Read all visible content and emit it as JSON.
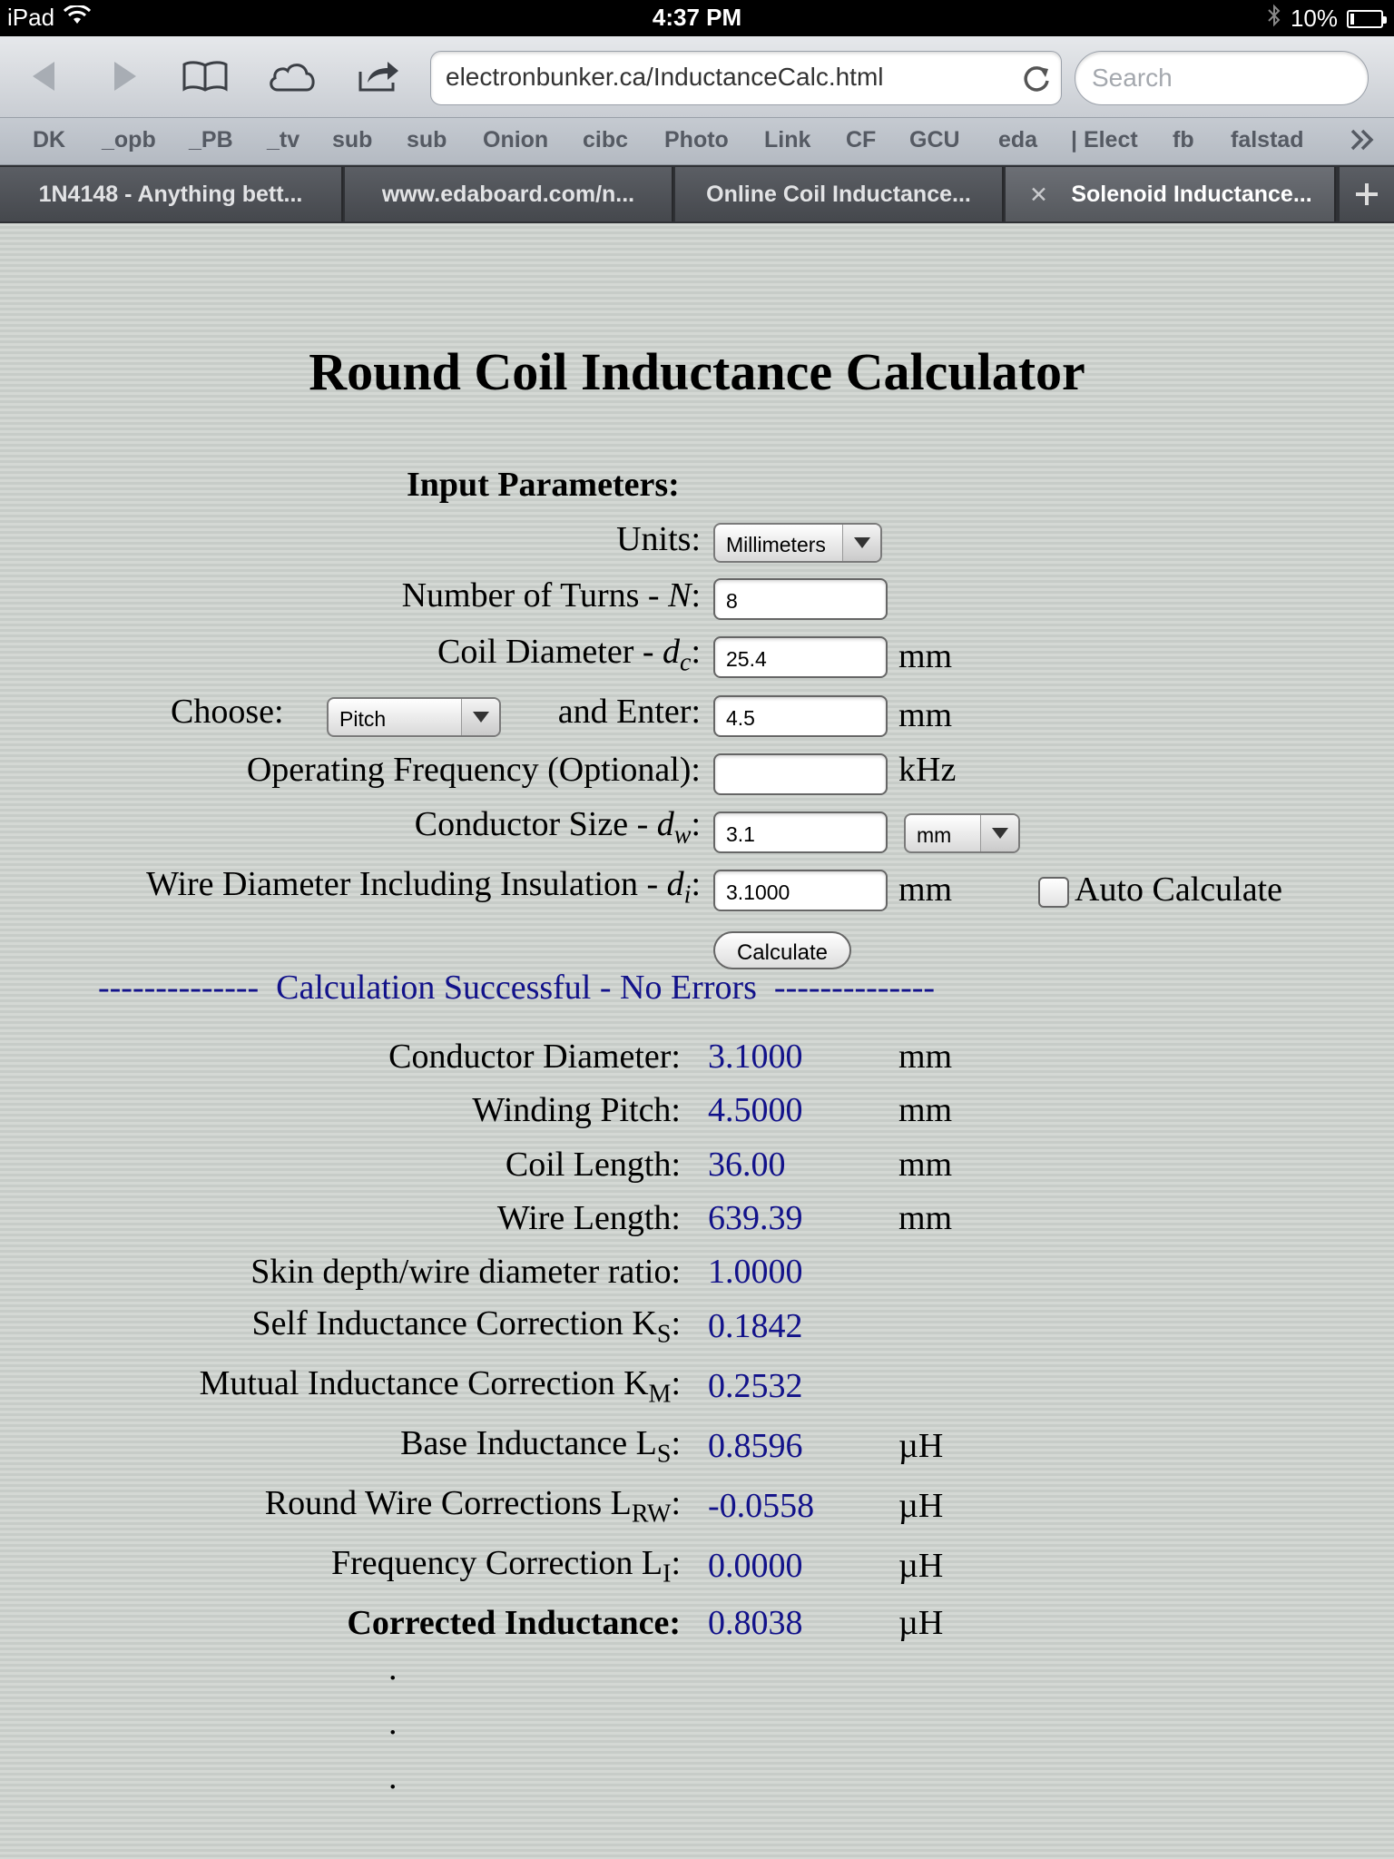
{
  "status_bar": {
    "device": "iPad",
    "time": "4:37 PM",
    "battery": "10%"
  },
  "toolbar": {
    "url": "electronbunker.ca/InductanceCalc.html",
    "search_placeholder": "Search"
  },
  "bookmarks": [
    "DK",
    "_opb",
    "_PB",
    "_tv",
    "sub",
    "sub",
    "Onion",
    "cibc",
    "Photo",
    "Link",
    "CF",
    "GCU",
    "eda",
    "| Elect",
    "fb",
    "falstad"
  ],
  "tabs": [
    {
      "label": "1N4148 - Anything bett..."
    },
    {
      "label": "www.edaboard.com/n..."
    },
    {
      "label": "Online Coil Inductance..."
    },
    {
      "label": "Solenoid Inductance..."
    }
  ],
  "page": {
    "title": "Round Coil Inductance Calculator",
    "input_heading": "Input Parameters:",
    "units_label": "Units:",
    "units_value": "Millimeters",
    "turns_label": "Number of Turns - ",
    "turns_var": "N",
    "turns_value": "8",
    "coil_dia_label": "Coil Diameter - ",
    "coil_dia_var": "d",
    "coil_dia_sub": "c",
    "coil_dia_value": "25.4",
    "choose_label": "Choose:",
    "choose_value": "Pitch",
    "and_enter_label": "and Enter:",
    "pitch_value": "4.5",
    "freq_label": "Operating Frequency (Optional):",
    "freq_value": "",
    "freq_unit": "kHz",
    "cond_size_label": "Conductor Size - ",
    "cond_size_var": "d",
    "cond_size_sub": "w",
    "cond_size_value": "3.1",
    "cond_size_unit": "mm",
    "wire_dia_label": "Wire Diameter Including Insulation - ",
    "wire_dia_var": "d",
    "wire_dia_sub": "i",
    "wire_dia_value": "3.1000",
    "auto_calc_label": "Auto Calculate",
    "unit_mm": "mm",
    "calculate_label": "Calculate",
    "status_message": "--------------  Calculation Successful - No Errors  --------------"
  },
  "results": [
    {
      "label": "Conductor Diameter:",
      "value": "3.1000",
      "unit": "mm"
    },
    {
      "label": "Winding Pitch:",
      "value": "4.5000",
      "unit": "mm"
    },
    {
      "label": "Coil Length:",
      "value": "36.00",
      "unit": "mm"
    },
    {
      "label": "Wire Length:",
      "value": "639.39",
      "unit": "mm"
    },
    {
      "label": "Skin depth/wire diameter ratio:",
      "value": "1.0000",
      "unit": ""
    },
    {
      "label": "Self Inductance Correction K",
      "sub": "S",
      "value": "0.1842",
      "unit": ""
    },
    {
      "label": "Mutual Inductance Correction K",
      "sub": "M",
      "value": "0.2532",
      "unit": ""
    },
    {
      "label": "Base Inductance L",
      "sub": "S",
      "value": "0.8596",
      "unit": "µH"
    },
    {
      "label": "Round Wire Corrections L",
      "sub": "RW",
      "value": "-0.0558",
      "unit": "µH"
    },
    {
      "label": "Frequency Correction L",
      "sub": "I",
      "value": "0.0000",
      "unit": "µH"
    },
    {
      "label": "Corrected Inductance:",
      "value": "0.8038",
      "unit": "µH",
      "bold": true
    }
  ],
  "dots": [
    ".",
    ".",
    "."
  ]
}
